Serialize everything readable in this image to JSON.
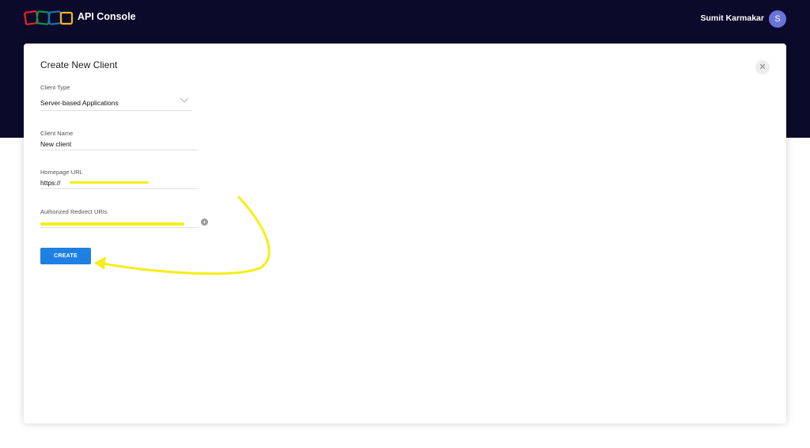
{
  "header": {
    "app_title": "API Console",
    "user_name": "Sumit Karmakar",
    "avatar_initial": "S"
  },
  "modal": {
    "title": "Create New Client",
    "close_icon": "close-icon",
    "fields": {
      "client_type": {
        "label": "Client Type",
        "value": "Server-based Applications"
      },
      "client_name": {
        "label": "Client Name",
        "value": "New client"
      },
      "homepage_url": {
        "label": "Homepage URL",
        "value": "https://"
      },
      "redirect_uris": {
        "label": "Authorized Redirect URIs",
        "value": ""
      }
    },
    "add_icon": "plus-circle-icon",
    "create_label": "CREATE"
  },
  "colors": {
    "header_bg": "#0c0a2a",
    "accent": "#1f7fe3",
    "annotation": "#f5ee18"
  }
}
